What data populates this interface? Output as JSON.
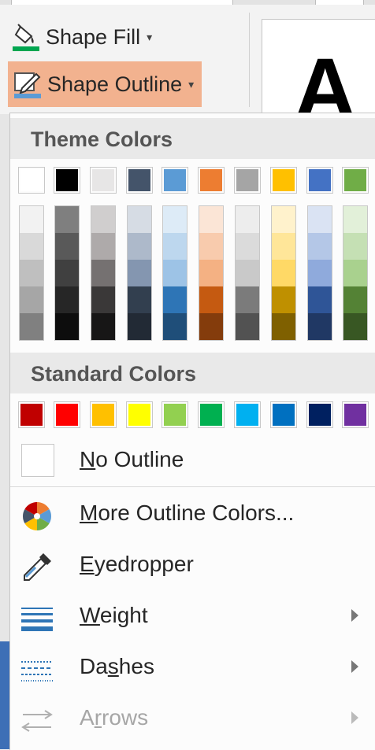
{
  "ribbon": {
    "shape_fill_label": "Shape Fill",
    "shape_outline_label": "Shape Outline",
    "wordart_glyph": "A",
    "caret": "▾"
  },
  "menu": {
    "theme_colors_title": "Theme Colors",
    "standard_colors_title": "Standard Colors",
    "theme_top_row": [
      "#ffffff",
      "#000000",
      "#e7e6e6",
      "#44546a",
      "#5b9bd5",
      "#ed7d31",
      "#a5a5a5",
      "#ffc000",
      "#4472c4",
      "#70ad47"
    ],
    "theme_shades": [
      [
        "#f2f2f2",
        "#d9d9d9",
        "#bfbfbf",
        "#a6a6a6",
        "#808080"
      ],
      [
        "#7f7f7f",
        "#595959",
        "#404040",
        "#262626",
        "#0d0d0d"
      ],
      [
        "#d0cece",
        "#aeaaaa",
        "#757171",
        "#3a3838",
        "#171616"
      ],
      [
        "#d6dce4",
        "#adb9ca",
        "#8496b0",
        "#323f4f",
        "#222a35"
      ],
      [
        "#ddebf7",
        "#bdd7ee",
        "#9dc3e6",
        "#2e75b6",
        "#1f4e79"
      ],
      [
        "#fbe5d6",
        "#f8cbad",
        "#f4b183",
        "#c55a11",
        "#843c0c"
      ],
      [
        "#ededed",
        "#dbdbdb",
        "#c9c9c9",
        "#7b7b7b",
        "#525252"
      ],
      [
        "#fff2cc",
        "#ffe699",
        "#ffd966",
        "#bf9000",
        "#7f6000"
      ],
      [
        "#dae3f3",
        "#b4c7e7",
        "#8faadc",
        "#2f5597",
        "#203864"
      ],
      [
        "#e2f0d9",
        "#c5e0b4",
        "#a9d18e",
        "#548235",
        "#385723"
      ]
    ],
    "standard_row": [
      "#c00000",
      "#ff0000",
      "#ffc000",
      "#ffff00",
      "#92d050",
      "#00b050",
      "#00b0f0",
      "#0070c0",
      "#002060",
      "#7030a0"
    ],
    "no_outline": {
      "mnemonic": "N",
      "rest": "o Outline"
    },
    "more_colors": {
      "mnemonic": "M",
      "rest": "ore Outline Colors..."
    },
    "eyedropper": {
      "mnemonic": "E",
      "rest": "yedropper"
    },
    "weight": {
      "mnemonic": "W",
      "rest": "eight"
    },
    "dashes": {
      "pre": "Da",
      "mnemonic": "s",
      "rest": "hes"
    },
    "arrows": {
      "pre": "A",
      "mnemonic": "r",
      "rest": "rows"
    },
    "icons": {
      "fill": "paint-bucket-icon",
      "outline": "pencil-outline-icon",
      "more_colors": "color-wheel-icon",
      "eyedropper": "eyedropper-icon",
      "weight": "line-weight-icon",
      "dashes": "dashes-icon",
      "arrows": "arrows-icon"
    }
  }
}
